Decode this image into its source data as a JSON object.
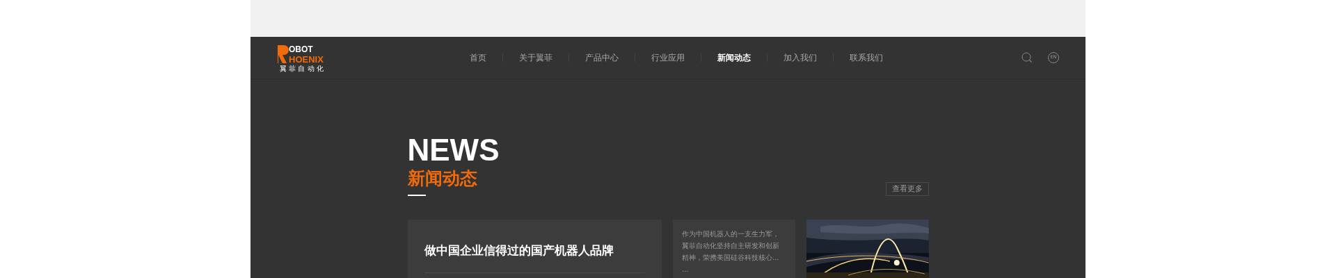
{
  "header": {
    "logo": {
      "line1": "OBOT",
      "line2": "HOENIX",
      "tagline": "翼 菲 自 动 化"
    },
    "nav": [
      {
        "label": "首页",
        "selected": false
      },
      {
        "label": "关于翼菲",
        "selected": false
      },
      {
        "label": "产品中心",
        "selected": false
      },
      {
        "label": "行业应用",
        "selected": false
      },
      {
        "label": "新闻动态",
        "selected": true
      },
      {
        "label": "加入我们",
        "selected": false
      },
      {
        "label": "联系我们",
        "selected": false
      }
    ],
    "language": "EN"
  },
  "news": {
    "title": "NEWS",
    "subtitle": "新闻动态",
    "more_button": "查看更多",
    "featured": {
      "title": "做中国企业信得过的国产机器人品牌"
    },
    "summary": "作为中国机器人的一支生力军，翼菲自动化坚持自主研发和创新精神，荣携美国硅谷科技核心... ..."
  }
}
